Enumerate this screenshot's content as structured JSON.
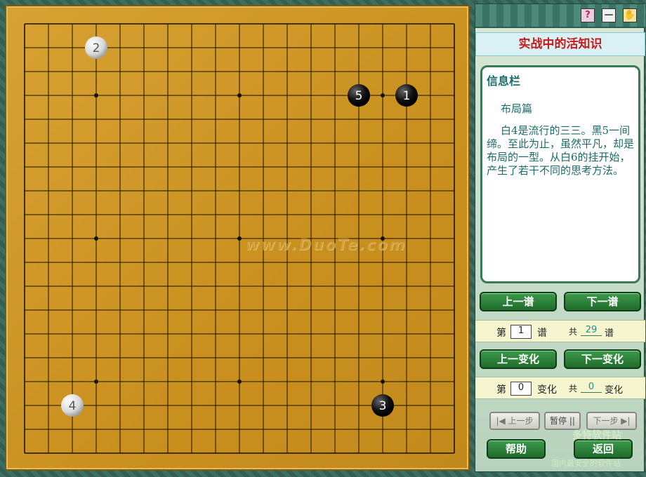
{
  "board": {
    "size": 19,
    "star_points": [
      [
        3,
        3
      ],
      [
        9,
        3
      ],
      [
        15,
        3
      ],
      [
        3,
        9
      ],
      [
        9,
        9
      ],
      [
        15,
        9
      ],
      [
        3,
        15
      ],
      [
        9,
        15
      ],
      [
        15,
        15
      ]
    ],
    "stones": [
      {
        "col": 3,
        "row": 1,
        "color": "white",
        "number": "2"
      },
      {
        "col": 14,
        "row": 3,
        "color": "black",
        "number": "5"
      },
      {
        "col": 16,
        "row": 3,
        "color": "black",
        "number": "1"
      },
      {
        "col": 2,
        "row": 16,
        "color": "white",
        "number": "4"
      },
      {
        "col": 15,
        "row": 16,
        "color": "black",
        "number": "3"
      }
    ],
    "watermark": "www.DuoTe.com"
  },
  "panel": {
    "title": "实战中的活知识",
    "info_heading": "信息栏",
    "info_subtitle": "布局篇",
    "info_body": "白4是流行的三三。黑5一间缔。至此为止，虽然平凡，却是布局的一型。从白6的挂开始，产生了若干不同的思考方法。",
    "prev_record_label": "上一谱",
    "next_record_label": "下一谱",
    "record_row": {
      "prefix": "第",
      "current": "1",
      "suffix": "谱",
      "total_prefix": "共",
      "total": "29",
      "total_suffix": "谱"
    },
    "prev_variation_label": "上一变化",
    "next_variation_label": "下一变化",
    "variation_row": {
      "prefix": "第",
      "current": "0",
      "suffix": "变化",
      "total_prefix": "共",
      "total": "0",
      "total_suffix": "变化"
    },
    "prev_step_label": "上一步",
    "pause_label": "暂停",
    "next_step_label": "下一步",
    "help_label": "帮助",
    "back_label": "返回",
    "brand_text": "多特软件站",
    "brand_sub": "国内最安全的软件站"
  },
  "system_buttons": [
    {
      "name": "help-system-icon",
      "glyph": "?"
    },
    {
      "name": "minimize-system-icon",
      "glyph": "—"
    },
    {
      "name": "exit-system-icon",
      "glyph": "✋"
    }
  ]
}
